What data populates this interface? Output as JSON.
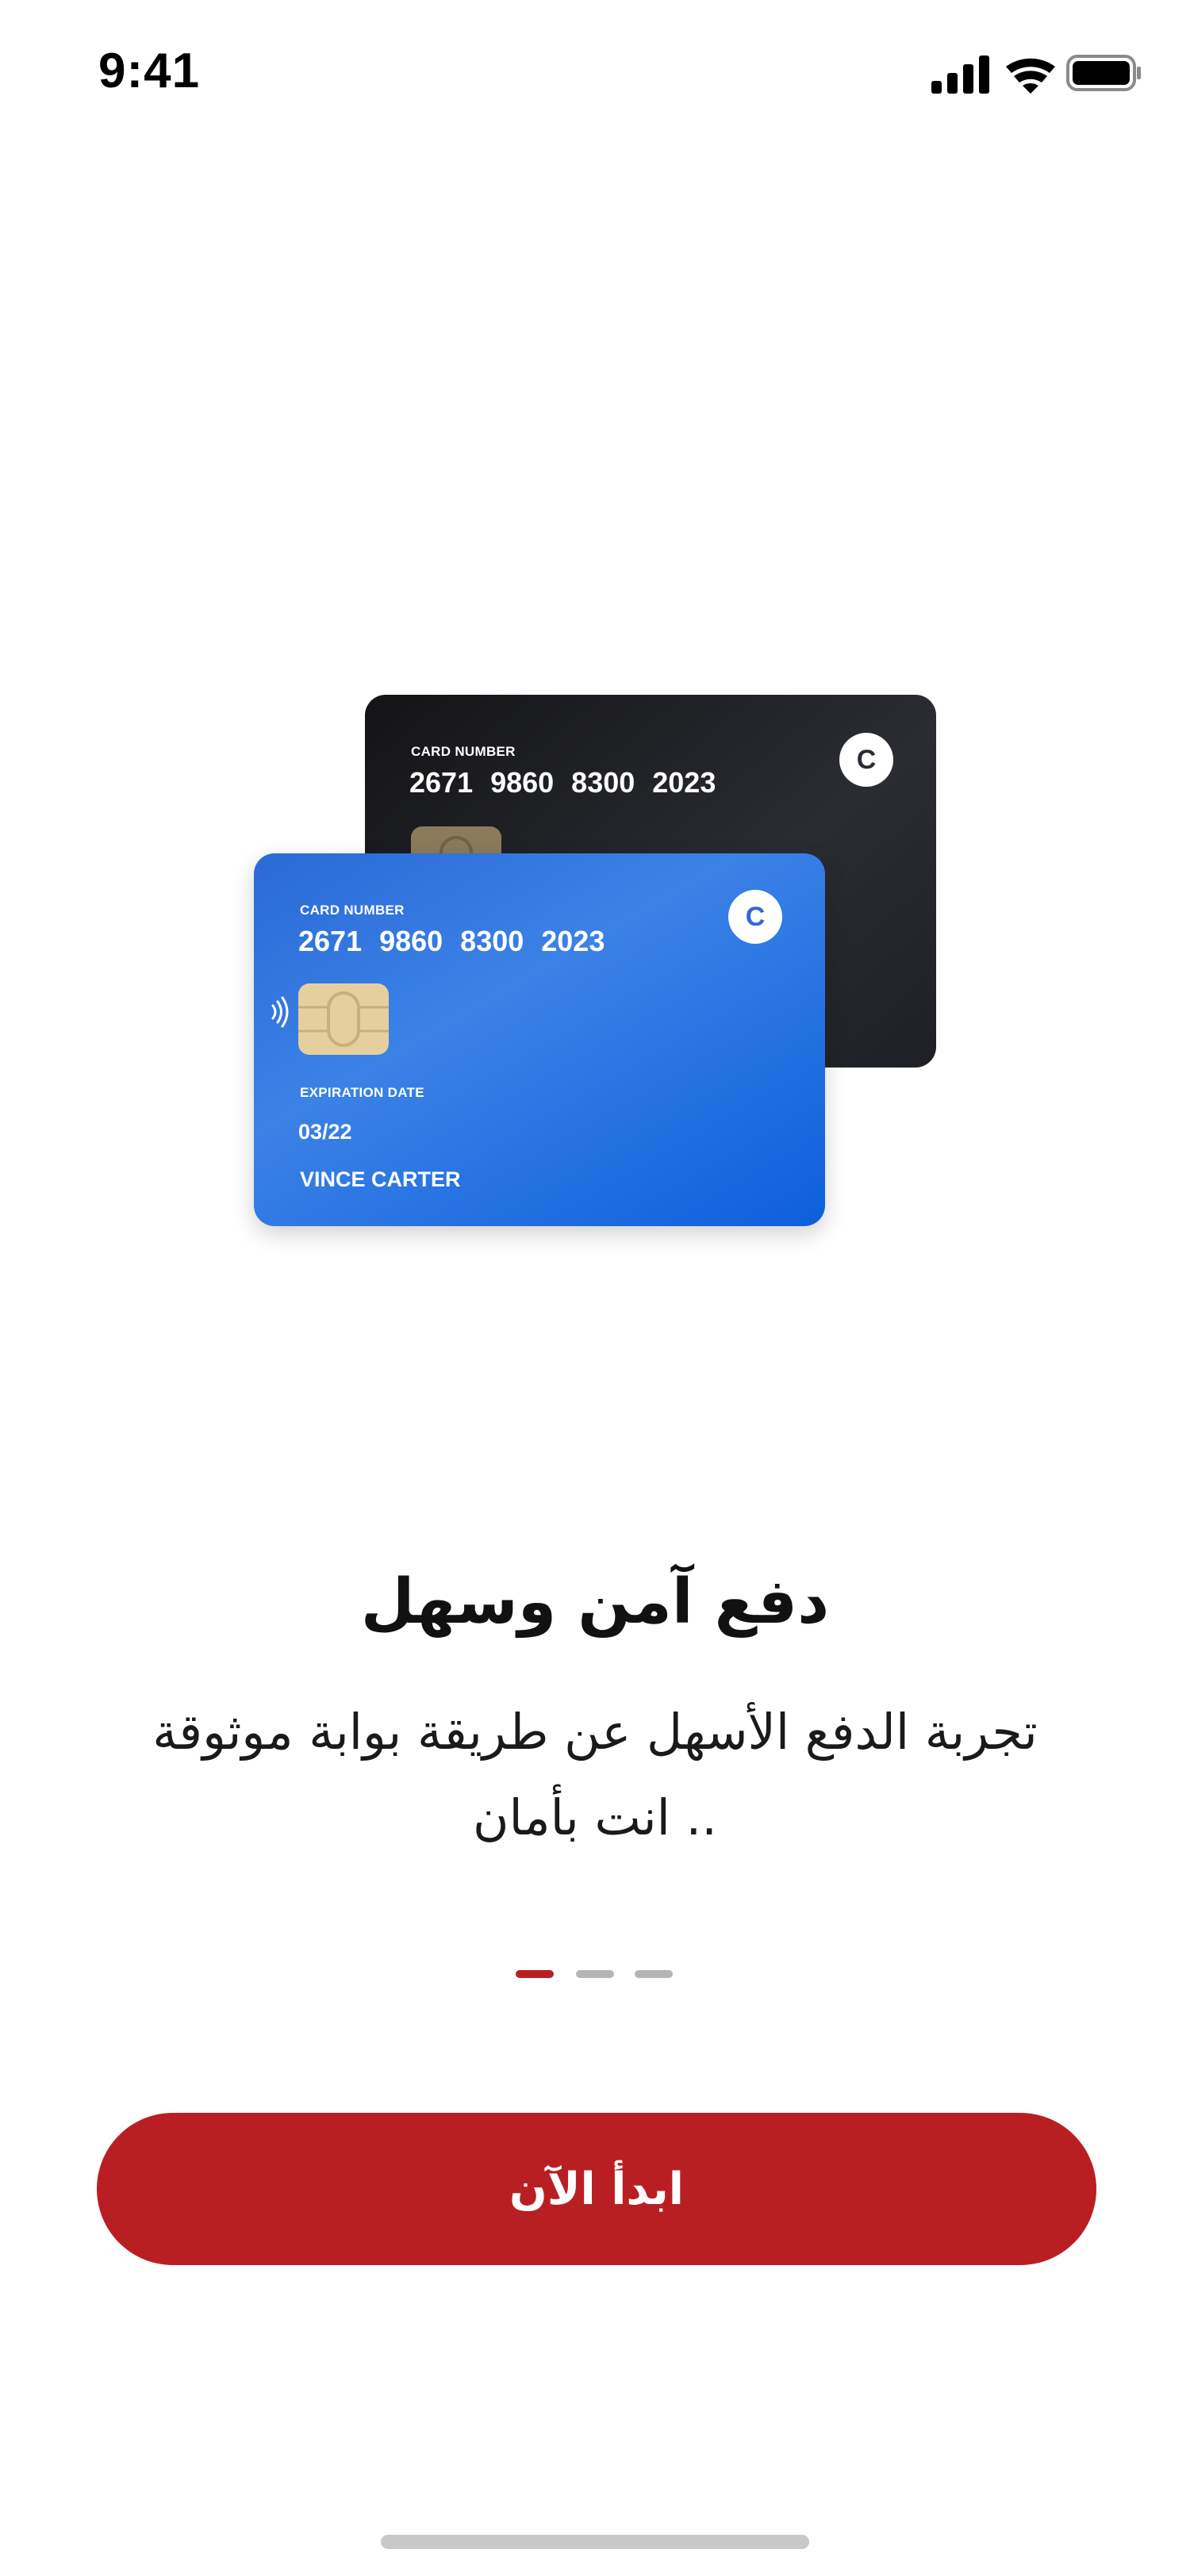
{
  "status_bar": {
    "time": "9:41",
    "icons": [
      "cellular-signal-icon",
      "wifi-icon",
      "battery-icon"
    ]
  },
  "cards": {
    "back_card": {
      "number_label": "CARD NUMBER",
      "number": "2671  9860  8300  2023",
      "logo_letter": "C",
      "logo_color": "#2a2c32"
    },
    "front_card": {
      "number_label": "CARD NUMBER",
      "number": "2671  9860  8300  2023",
      "logo_letter": "C",
      "logo_color": "#2a6ad6",
      "expiration_label": "EXPIRATION DATE",
      "expiration": "03/22",
      "holder": "VINCE CARTER"
    }
  },
  "onboarding": {
    "title": "دفع آمن وسهل",
    "description": "تجربة الدفع الأسهل عن طريقة بوابة موثوقة .. انت بأمان",
    "pages_total": 3,
    "active_page": 1
  },
  "cta": {
    "label": "ابدأ الآن"
  },
  "colors": {
    "primary": "#b91f22",
    "dot_active": "#b91f22",
    "dot_inactive": "#b5b5b5",
    "card_blue": "#1e6ae0",
    "card_black": "#1c1d21"
  }
}
